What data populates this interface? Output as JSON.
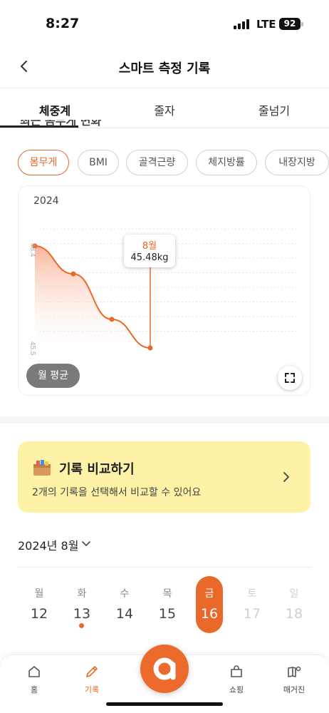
{
  "status_bar": {
    "time": "8:27",
    "network": "LTE",
    "battery": "92"
  },
  "header": {
    "title": "스마트 측정 기록",
    "back_icon": "chevron-left-icon"
  },
  "tabs": [
    {
      "label": "체중계",
      "active": true
    },
    {
      "label": "줄자",
      "active": false
    },
    {
      "label": "줄넘기",
      "active": false
    }
  ],
  "cut_heading": "최근 몸무게 변화",
  "metric_chips": [
    {
      "label": "몸무게",
      "active": true
    },
    {
      "label": "BMI",
      "active": false
    },
    {
      "label": "골격근량",
      "active": false
    },
    {
      "label": "체지방률",
      "active": false
    },
    {
      "label": "내장지방",
      "active": false
    }
  ],
  "chart": {
    "year": "2024",
    "average_toggle": "월 평균",
    "tooltip": {
      "month": "8월",
      "value": "45.48kg"
    },
    "expand_icon": "expand-icon"
  },
  "chart_data": {
    "type": "area",
    "y_tick_labels": [
      "48.4",
      "45.5"
    ],
    "ylim": [
      45.5,
      48.4
    ],
    "values": [
      48.4,
      47.6,
      46.3,
      45.48
    ],
    "highlighted": {
      "label": "8월",
      "value": 45.48
    },
    "colors": {
      "line": "#e8692a",
      "fill": "#f6a98a"
    },
    "grid": true
  },
  "compare_card": {
    "icon": "box-icon",
    "title": "기록 비교하기",
    "subtitle": "2개의 기록을 선택해서 비교할 수 있어요"
  },
  "month_picker": {
    "label": "2024년 8월"
  },
  "week": [
    {
      "name": "월",
      "num": "12",
      "state": "normal",
      "dot": false
    },
    {
      "name": "화",
      "num": "13",
      "state": "normal",
      "dot": true
    },
    {
      "name": "수",
      "num": "14",
      "state": "normal",
      "dot": false
    },
    {
      "name": "목",
      "num": "15",
      "state": "normal",
      "dot": false
    },
    {
      "name": "금",
      "num": "16",
      "state": "selected",
      "dot": false
    },
    {
      "name": "토",
      "num": "17",
      "state": "dim",
      "dot": false
    },
    {
      "name": "일",
      "num": "18",
      "state": "dim",
      "dot": false
    }
  ],
  "bottom_nav": [
    {
      "label": "홈",
      "icon": "home-icon",
      "active": false
    },
    {
      "label": "기록",
      "icon": "pencil-icon",
      "active": true
    },
    {
      "label": "쇼핑",
      "icon": "shopping-bag-icon",
      "active": false
    },
    {
      "label": "매거진",
      "icon": "magazine-icon",
      "active": false
    }
  ],
  "colors": {
    "accent": "#e8692a",
    "card_yellow": "#fdf2a6"
  }
}
